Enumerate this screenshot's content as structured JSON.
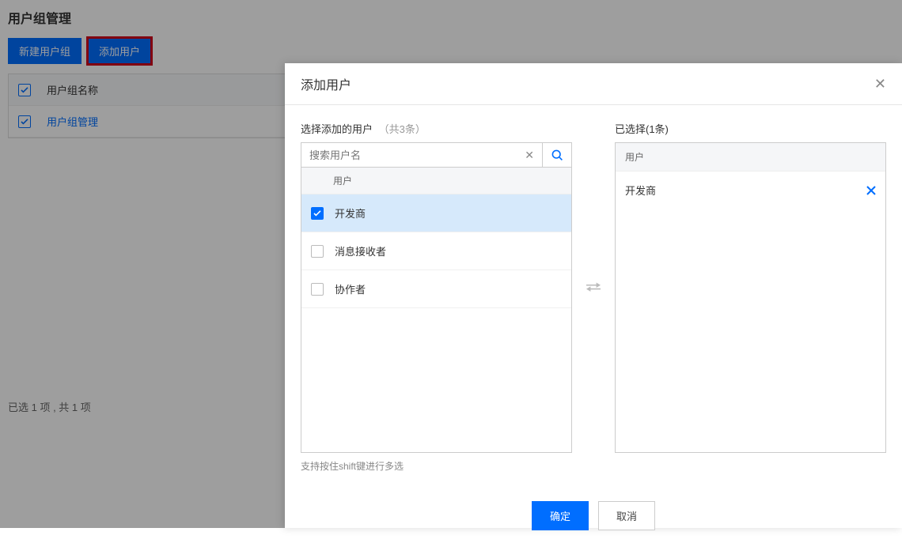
{
  "page": {
    "title": "用户组管理",
    "toolbar": {
      "newGroup": "新建用户组",
      "addUser": "添加用户"
    },
    "table": {
      "columnHeader": "用户组名称",
      "rowName": "用户组管理"
    },
    "summary": "已选 1 项 , 共 1 项"
  },
  "modal": {
    "title": "添加用户",
    "leftTitle": "选择添加的用户",
    "leftCount": "（共3条）",
    "searchPlaceholder": "搜索用户名",
    "listHeader": "用户",
    "users": {
      "u0": "开发商",
      "u1": "消息接收者",
      "u2": "协作者"
    },
    "rightTitle": "已选择(1条)",
    "rightHeader": "用户",
    "selected0": "开发商",
    "hint": "支持按住shift键进行多选",
    "footer": {
      "confirm": "确定",
      "cancel": "取消"
    }
  }
}
